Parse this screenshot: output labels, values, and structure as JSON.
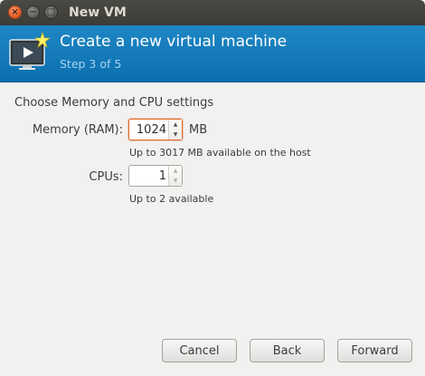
{
  "window": {
    "title": "New VM",
    "controls": {
      "close": "×",
      "minimize": "−",
      "maximize": "□"
    }
  },
  "banner": {
    "icon": "monitor-play-icon",
    "title": "Create a new virtual machine",
    "step": "Step 3 of 5"
  },
  "section_title": "Choose Memory and CPU settings",
  "memory": {
    "label": "Memory (RAM):",
    "value": "1024",
    "unit": "MB",
    "hint": "Up to 3017 MB available on the host"
  },
  "cpus": {
    "label": "CPUs:",
    "value": "1",
    "hint": "Up to 2 available"
  },
  "spin_glyphs": {
    "up": "▲",
    "down": "▼"
  },
  "buttons": {
    "cancel": "Cancel",
    "back": "Back",
    "forward": "Forward"
  },
  "colors": {
    "banner": "#1a7fbf",
    "focus": "#e06b2e",
    "titlebar": "#3c3b37"
  }
}
